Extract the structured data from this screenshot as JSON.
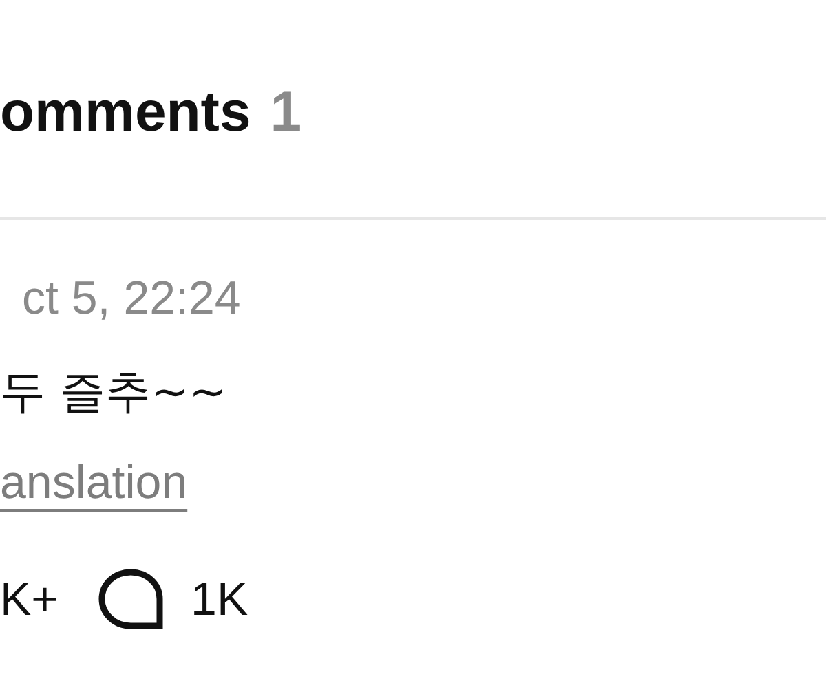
{
  "header": {
    "title": "omments",
    "count": "1"
  },
  "comment": {
    "time": "ct 5, 22:24",
    "text": "두 즐추~~",
    "translation_link": "anslation",
    "likes": "K+",
    "replies": "1K"
  }
}
